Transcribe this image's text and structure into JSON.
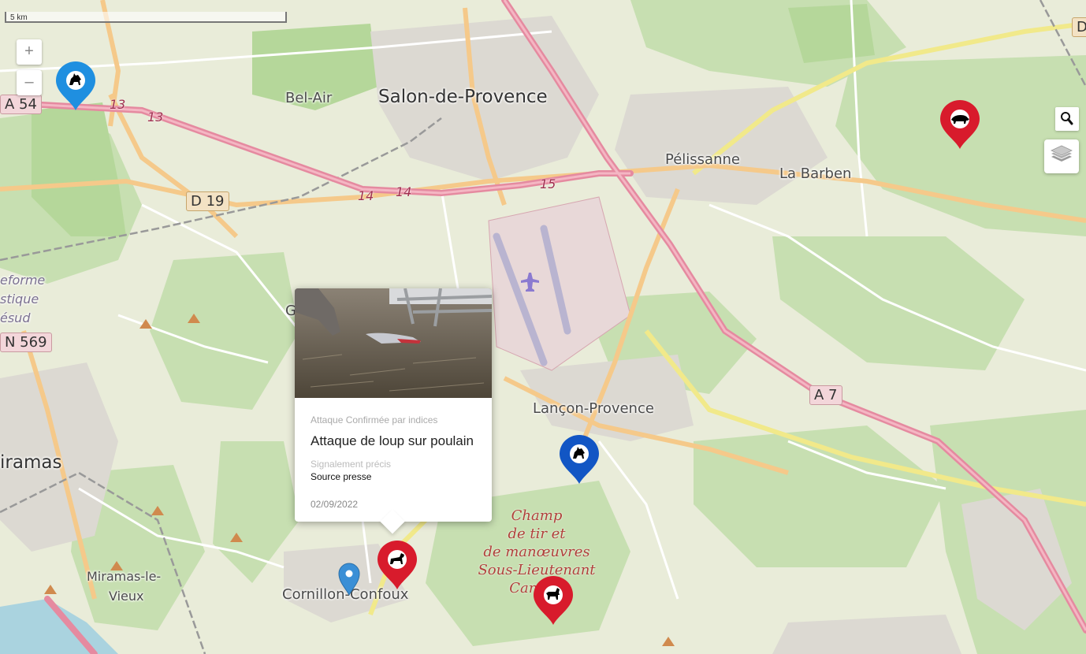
{
  "scale": {
    "label": "5 km"
  },
  "zoom": {
    "in_label": "+",
    "out_label": "–"
  },
  "places": {
    "salon": "Salon-de-Provence",
    "bel_air": "Bel-Air",
    "pelissanne": "Pélissanne",
    "la_barben": "La Barben",
    "lancon": "Lançon-Provence",
    "miramas": "iramas",
    "miramas_vieux_1": "Miramas-le-",
    "miramas_vieux_2": "Vieux",
    "cornillon": "Cornillon-Confoux",
    "reforme_1": "eforme",
    "reforme_2": "stique",
    "reforme_3": "ésud",
    "g_partial": "G"
  },
  "roads": {
    "a54": "A 54",
    "d19": "D 19",
    "n569": "N 569",
    "a7": "A 7",
    "d_partial": "D",
    "exit_13a": "13",
    "exit_13b": "13",
    "exit_14a": "14",
    "exit_14b": "14",
    "exit_15": "15"
  },
  "military_area": {
    "line1": "Champ",
    "line2": "de tir et",
    "line3": "de manœuvres",
    "line4": "Sous-Lieutenant",
    "line5": "Camp     e"
  },
  "markers": [
    {
      "id": "wolf-blue-nw",
      "color": "#1f8fe0",
      "icon": "wolf-icon"
    },
    {
      "id": "boar-red-ne",
      "color": "#d81b2c",
      "icon": "boar-icon"
    },
    {
      "id": "wolf-blue-lancon",
      "color": "#1256c4",
      "icon": "wolf-icon"
    },
    {
      "id": "horse-red-cornillon",
      "color": "#d81b2c",
      "icon": "horse-icon"
    },
    {
      "id": "goat-red-camp",
      "color": "#d81b2c",
      "icon": "goat-icon"
    },
    {
      "id": "location-small-blue",
      "color": "#3a8fd6",
      "icon": "location-pin-icon"
    }
  ],
  "popup": {
    "status": "Attaque Confirmée par indices",
    "title": "Attaque de loup sur poulain",
    "precision": "Signalement précis",
    "source": "Source presse",
    "date": "02/09/2022"
  },
  "colors": {
    "red_marker": "#d81b2c",
    "blue_marker": "#1f8fe0",
    "dark_blue_marker": "#1256c4",
    "motorway": "#e58aa0",
    "primary_road": "#f9d9a0",
    "secondary_road": "#f7f4a0",
    "forest": "#add19e"
  }
}
